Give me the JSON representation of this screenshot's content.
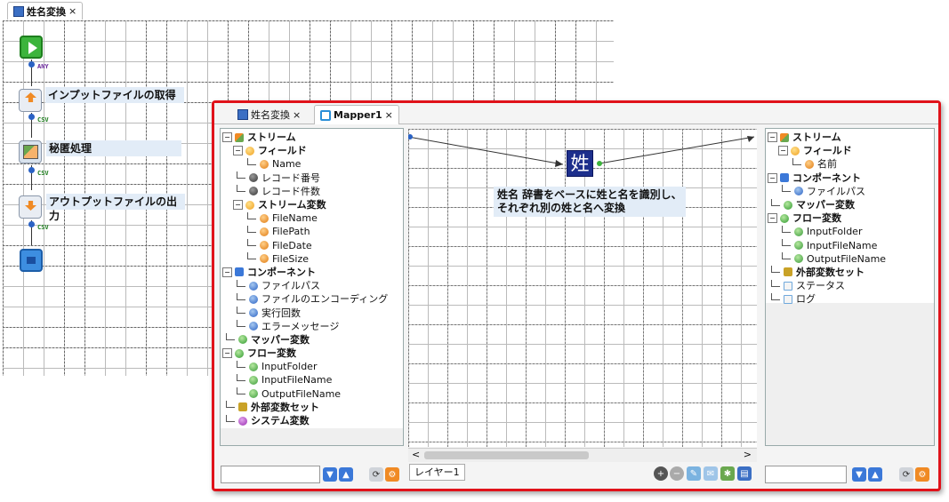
{
  "outer_tab": {
    "title": "姓名変換",
    "close": "×"
  },
  "flow": {
    "nodes": [
      {
        "label": ""
      },
      {
        "label": "インプットファイルの取得"
      },
      {
        "label": "秘匿処理"
      },
      {
        "label": "アウトプットファイルの出力"
      },
      {
        "label": ""
      }
    ],
    "connectors": [
      "ANY",
      "CSV",
      "CSV",
      "CSV"
    ]
  },
  "mapper": {
    "tabs": [
      {
        "title": "姓名変換",
        "close": "×"
      },
      {
        "title": "Mapper1",
        "close": "×"
      }
    ],
    "left_tree": [
      {
        "label": "ストリーム",
        "bold": true,
        "depth": 0,
        "icon": "stream"
      },
      {
        "label": "フィールド",
        "bold": true,
        "depth": 1,
        "icon": "bulb-orange"
      },
      {
        "label": "Name",
        "bold": false,
        "depth": 2,
        "icon": "dot-orange"
      },
      {
        "label": "レコード番号",
        "bold": false,
        "depth": 1,
        "icon": "dot-dark"
      },
      {
        "label": "レコード件数",
        "bold": false,
        "depth": 1,
        "icon": "dot-dark"
      },
      {
        "label": "ストリーム変数",
        "bold": true,
        "depth": 1,
        "icon": "bulb-orange"
      },
      {
        "label": "FileName",
        "bold": false,
        "depth": 2,
        "icon": "dot-orange"
      },
      {
        "label": "FilePath",
        "bold": false,
        "depth": 2,
        "icon": "dot-orange"
      },
      {
        "label": "FileDate",
        "bold": false,
        "depth": 2,
        "icon": "dot-orange"
      },
      {
        "label": "FileSize",
        "bold": false,
        "depth": 2,
        "icon": "dot-orange"
      },
      {
        "label": "コンポーネント",
        "bold": true,
        "depth": 0,
        "icon": "component"
      },
      {
        "label": "ファイルパス",
        "bold": false,
        "depth": 1,
        "icon": "dot-blue"
      },
      {
        "label": "ファイルのエンコーディング",
        "bold": false,
        "depth": 1,
        "icon": "dot-blue"
      },
      {
        "label": "実行回数",
        "bold": false,
        "depth": 1,
        "icon": "dot-blue"
      },
      {
        "label": "エラーメッセージ",
        "bold": false,
        "depth": 1,
        "icon": "dot-blue"
      },
      {
        "label": "マッパー変数",
        "bold": true,
        "depth": 0,
        "icon": "bulb-green"
      },
      {
        "label": "フロー変数",
        "bold": true,
        "depth": 0,
        "icon": "bulb-green"
      },
      {
        "label": "InputFolder",
        "bold": false,
        "depth": 1,
        "icon": "dot-green"
      },
      {
        "label": "InputFileName",
        "bold": false,
        "depth": 1,
        "icon": "dot-green"
      },
      {
        "label": "OutputFileName",
        "bold": false,
        "depth": 1,
        "icon": "dot-green"
      },
      {
        "label": "外部変数セット",
        "bold": true,
        "depth": 0,
        "icon": "extvars"
      },
      {
        "label": "システム変数",
        "bold": true,
        "depth": 0,
        "icon": "bulb-purple"
      }
    ],
    "right_tree": [
      {
        "label": "ストリーム",
        "bold": true,
        "depth": 0,
        "icon": "stream"
      },
      {
        "label": "フィールド",
        "bold": true,
        "depth": 1,
        "icon": "bulb-orange"
      },
      {
        "label": "名前",
        "bold": false,
        "depth": 2,
        "icon": "dot-orange"
      },
      {
        "label": "コンポーネント",
        "bold": true,
        "depth": 0,
        "icon": "component"
      },
      {
        "label": "ファイルパス",
        "bold": false,
        "depth": 1,
        "icon": "dot-blue"
      },
      {
        "label": "マッパー変数",
        "bold": true,
        "depth": 0,
        "icon": "bulb-green"
      },
      {
        "label": "フロー変数",
        "bold": true,
        "depth": 0,
        "icon": "bulb-green"
      },
      {
        "label": "InputFolder",
        "bold": false,
        "depth": 1,
        "icon": "dot-green"
      },
      {
        "label": "InputFileName",
        "bold": false,
        "depth": 1,
        "icon": "dot-green"
      },
      {
        "label": "OutputFileName",
        "bold": false,
        "depth": 1,
        "icon": "dot-green"
      },
      {
        "label": "外部変数セット",
        "bold": true,
        "depth": 0,
        "icon": "extvars"
      },
      {
        "label": "ステータス",
        "bold": false,
        "depth": 0,
        "icon": "doc"
      },
      {
        "label": "ログ",
        "bold": false,
        "depth": 0,
        "icon": "doc"
      }
    ],
    "function_icon": "姓",
    "annotation": [
      "姓名 辞書をベースに姓と名を識別し、",
      "それぞれ別の姓と名へ変換"
    ],
    "layer_tab": "レイヤー1",
    "scroll_left": "<",
    "scroll_right": ">"
  },
  "colors": {
    "accent_red": "#e0121a",
    "node_label_bg": "#e2ecf7",
    "function_bg": "#1d2f8c"
  }
}
